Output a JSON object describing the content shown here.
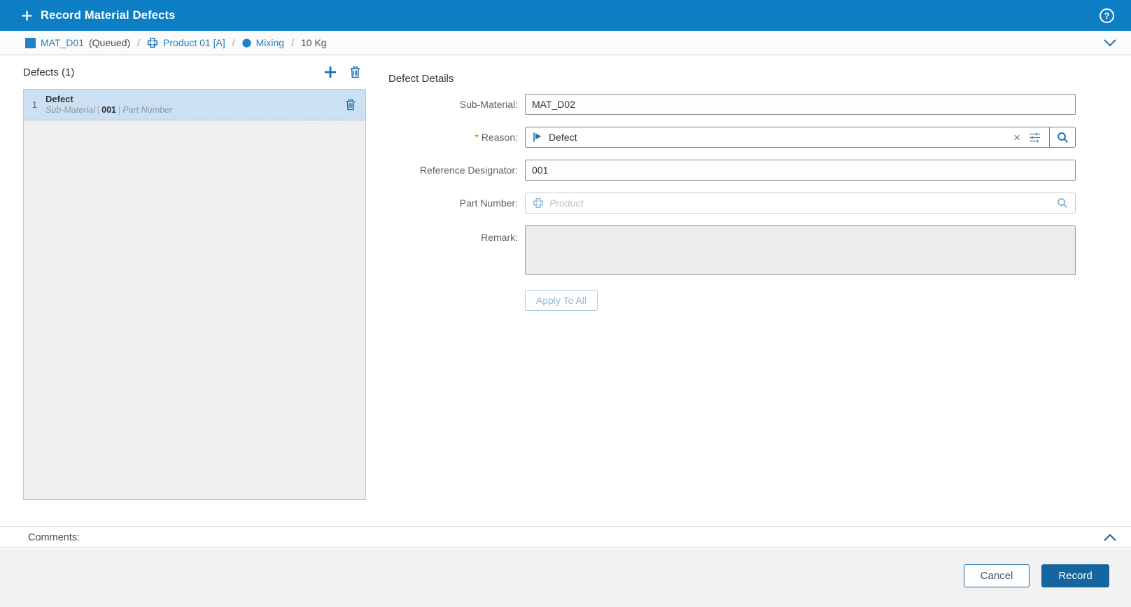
{
  "titlebar": {
    "title": "Record Material Defects",
    "help_glyph": "?"
  },
  "breadcrumb": {
    "material_label": "MAT_D01",
    "material_status": "(Queued)",
    "separator": "/",
    "product_label": "Product 01 [A]",
    "operation_label": "Mixing",
    "quantity": "10 Kg"
  },
  "defects_panel": {
    "title": "Defects (1)",
    "items": [
      {
        "index": "1",
        "title": "Defect",
        "sub_material_text": "Sub-Material",
        "separator": "|",
        "reference": "001",
        "part_text": "Part Number"
      }
    ]
  },
  "details": {
    "title": "Defect Details",
    "sub_material": {
      "label": "Sub-Material:",
      "value": "MAT_D02"
    },
    "reason": {
      "required_mark": "*",
      "label": "Reason:",
      "value": "Defect",
      "clear_glyph": "×"
    },
    "reference_designator": {
      "label": "Reference Designator:",
      "value": "001"
    },
    "part_number": {
      "label": "Part Number:",
      "placeholder": "Product"
    },
    "remark": {
      "label": "Remark:",
      "value": ""
    },
    "apply_to_all_label": "Apply To All"
  },
  "comments": {
    "label": "Comments:"
  },
  "footer": {
    "cancel_label": "Cancel",
    "record_label": "Record"
  },
  "colors": {
    "header_blue": "#0d7dc4",
    "link_blue": "#1e82c4",
    "icon_blue": "#1b6fae",
    "selected_row": "#cbe0f3",
    "record_button": "#15659e",
    "required_asterisk": "#cc8400"
  }
}
